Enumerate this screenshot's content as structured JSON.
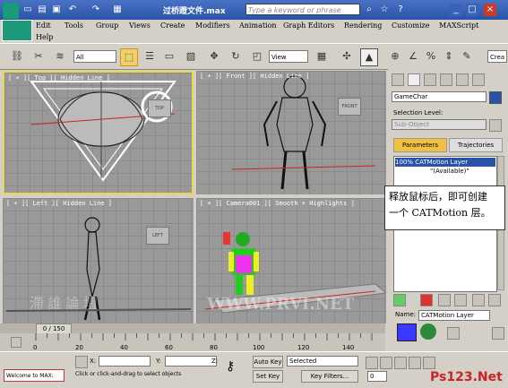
{
  "window": {
    "title": "过桥蹬文件.max",
    "search_placeholder": "Type a keyword or phrase"
  },
  "menu": [
    "Edit",
    "Tools",
    "Group",
    "Views",
    "Create",
    "Modifiers",
    "Animation",
    "Graph Editors",
    "Rendering",
    "Customize",
    "MAXScript",
    "Help"
  ],
  "toolbar": {
    "filter": "All",
    "coord": "View",
    "create_selection_set": "Crea"
  },
  "viewports": {
    "top": "[ + ][ Top ][ Hidden Line ]",
    "front": "[ + ][ Front ][ Hidden Line ]",
    "left": "[ + ][ Left ][ Hidden Line ]",
    "camera": "[ + ][ Camera001 ][ Smooth + Highlights ]",
    "cube_top": "TOP",
    "cube_front": "FRONT",
    "cube_left": "LEFT"
  },
  "panel": {
    "object_name": "GameChar",
    "selection_level_label": "Selection Level:",
    "sub_object": "Sub-Object",
    "tab_parameters": "Parameters",
    "tab_trajectories": "Trajectories",
    "layer_item": "100% CATMotion Layer",
    "layer_sub": "\"(Available)\"",
    "name_label": "Name:",
    "name_value": "CATMotion Layer"
  },
  "callout": {
    "line1": "释放鼠标后，即可创建",
    "line2": "一个 CATMotion 层。"
  },
  "timeline": {
    "slider": "0 / 150",
    "ticks": [
      "0",
      "20",
      "40",
      "60",
      "80",
      "100",
      "120",
      "140"
    ]
  },
  "status": {
    "maxscript": "Welcome to MAX:",
    "prompt": "Click or click-and-drag to select objects",
    "x_label": "X:",
    "y_label": "Y:",
    "z_label": "Z:",
    "auto_key": "Auto Key",
    "set_key": "Set Key",
    "selected": "Selected",
    "key_filters": "Key Filters...",
    "frame": "0"
  },
  "watermarks": {
    "left": "滯誰論壇",
    "center": "WWW.PRVI.NET",
    "corner": "Ps123.Net"
  },
  "colors": {
    "accent": "#2a52a8",
    "active_tab": "#f0c040",
    "selection": "#ffff00",
    "wire": "#ffff00"
  }
}
